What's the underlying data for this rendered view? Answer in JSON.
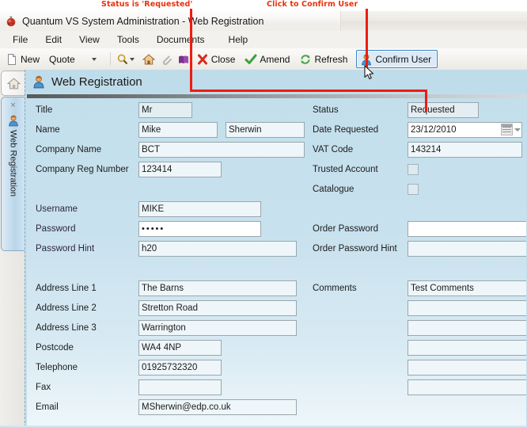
{
  "annotations": {
    "status_note": "Status is 'Requested'",
    "confirm_note": "Click to Confirm User"
  },
  "window": {
    "title": "Quantum VS System Administration -  Web Registration",
    "icon": "app-icon"
  },
  "menubar": {
    "items": [
      {
        "label": "File"
      },
      {
        "label": "Edit"
      },
      {
        "label": "View"
      },
      {
        "label": "Tools"
      },
      {
        "label": "Documents"
      },
      {
        "label": "Help"
      }
    ]
  },
  "toolbar": {
    "new_label": "New",
    "quote_label": "Quote",
    "search_icon": "magnifier-icon",
    "home_icon": "home-icon",
    "attach_icon": "paperclip-icon",
    "book_icon": "book-icon",
    "close_label": "Close",
    "amend_label": "Amend",
    "refresh_label": "Refresh",
    "confirm_user_label": "Confirm User"
  },
  "sidebar": {
    "home_tab": "home-icon",
    "web_tab_label": "Web Registration",
    "web_tab_close": "×"
  },
  "page": {
    "title": "Web Registration",
    "icon": "user-icon"
  },
  "form": {
    "left": [
      {
        "label": "Title",
        "value": "Mr"
      },
      {
        "label": "Name",
        "value": "Mike",
        "value2": "Sherwin"
      },
      {
        "label": "Company Name",
        "value": "BCT"
      },
      {
        "label": "Company Reg Number",
        "value": "123414"
      },
      {
        "label": "Username",
        "value": "MIKE"
      },
      {
        "label": "Password",
        "value": "•••••"
      },
      {
        "label": "Password Hint",
        "value": "h20"
      },
      {
        "label": "Address Line 1",
        "value": "The Barns"
      },
      {
        "label": "Address Line 2",
        "value": "Stretton Road"
      },
      {
        "label": "Address Line 3",
        "value": "Warrington"
      },
      {
        "label": "Postcode",
        "value": "WA4 4NP"
      },
      {
        "label": "Telephone",
        "value": "01925732320"
      },
      {
        "label": "Fax",
        "value": ""
      },
      {
        "label": "Email",
        "value": "MSherwin@edp.co.uk"
      }
    ],
    "right": [
      {
        "label": "Status",
        "value": "Requested"
      },
      {
        "label": "Date Requested",
        "value": "23/12/2010"
      },
      {
        "label": "VAT Code",
        "value": "143214"
      },
      {
        "label": "Trusted Account",
        "value": false
      },
      {
        "label": "Catalogue",
        "value": false
      },
      {
        "label": "Order Password",
        "value": ""
      },
      {
        "label": "Order Password Hint",
        "value": ""
      },
      {
        "label": "Comments",
        "value": "Test Comments"
      }
    ],
    "comments_extra": [
      "",
      "",
      "",
      "",
      ""
    ]
  },
  "colors": {
    "annotation_red": "#ee1c10",
    "panel_blue": "#c3dfec",
    "highlight_border": "#3c87c8"
  }
}
